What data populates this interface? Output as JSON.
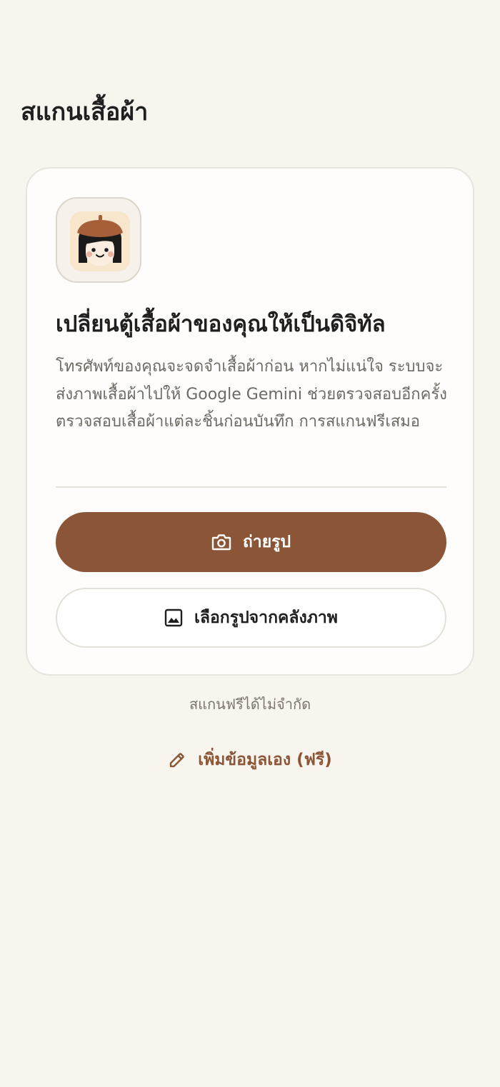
{
  "page": {
    "title": "สแกนเสื้อผ้า"
  },
  "card": {
    "avatar_icon": "girl-with-beret-avatar",
    "headline": "เปลี่ยนตู้เสื้อผ้าของคุณให้เป็นดิจิทัล",
    "description": "โทรศัพท์ของคุณจะจดจำเสื้อผ้าก่อน หากไม่แน่ใจ ระบบจะส่งภาพเสื้อผ้าไปให้ Google Gemini ช่วยตรวจสอบอีกครั้ง ตรวจสอบเสื้อผ้าแต่ละชิ้นก่อนบันทึก การสแกนฟรีเสมอ",
    "take_photo": {
      "label": "ถ่ายรูป",
      "icon": "camera-icon"
    },
    "choose_gallery": {
      "label": "เลือกรูปจากคลังภาพ",
      "icon": "image-icon"
    }
  },
  "hint": "สแกนฟรีได้ไม่จำกัด",
  "manual_entry": {
    "label": "เพิ่มข้อมูลเอง (ฟรี)",
    "icon": "pencil-icon"
  },
  "colors": {
    "background": "#f8f5ef",
    "card": "#fefdfb",
    "accent": "#8b5637",
    "text": "#1f1f1f",
    "muted": "#6e6963"
  }
}
